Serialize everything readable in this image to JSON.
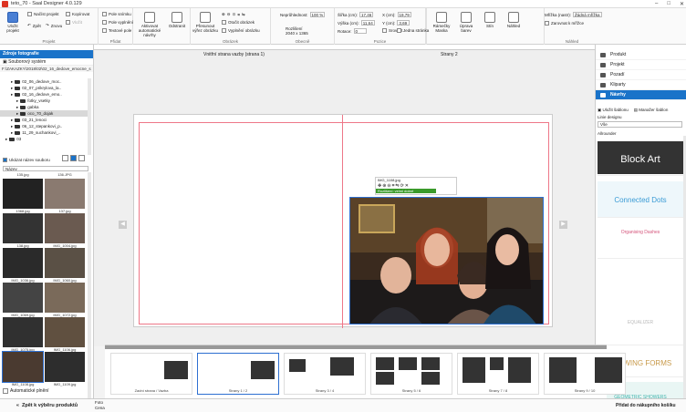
{
  "window": {
    "title": "teto_70 - Saal Designer 4.0.129"
  },
  "ribbon": {
    "save_project": "Uložit\nprojekt",
    "load_project": "Načíst projekt",
    "copy": "Kopírovat",
    "insert": "Vložit",
    "undo": "Zpět",
    "redo": "Znovu",
    "group_project": "Projekt",
    "photo_box": "Pole snímku",
    "fill_box": "Pole vyplnění",
    "text_box": "Textové pole",
    "group_add": "Přidat",
    "update_layouts": "Aktivovat automatické návrhy",
    "delete": "Odstranit",
    "move_image": "Přesunout výřez obrázku",
    "group_image": "Obrázek",
    "rotate_image": "Otočit obrázek",
    "fill_image": "Vyplnění obrázku",
    "resolution_label": "Rozlišení",
    "resolution_value": "2040 x 1365",
    "transparency_label": "Neprůhlednost:",
    "transparency_value": "100 %",
    "group_general": "Obecně",
    "width_label": "Šířka (cm):",
    "width_value": "17,46",
    "height_label": "Výška (cm):",
    "height_value": "11,64",
    "rotation_label": "Rotace:",
    "rotation_value": "0",
    "x_label": "X (cm):",
    "x_value": "19,79",
    "y_label": "Y (cm):",
    "y_value": "3,69",
    "align_label": "Srovnat",
    "single_page": "Jedna stránka",
    "group_position": "Pozice",
    "frames_mask": "Rámečky Maska",
    "filter_colors": "Úprava barev",
    "shadow": "Stín",
    "preview": "Náhled",
    "grid_label": "Mřížka (nastr):",
    "grid_value": "Žádná mřížka",
    "snap_grid": "Zarovnat k mřížce",
    "group_view": "Náhled"
  },
  "left": {
    "header": "Zdroje fotografie",
    "source": "Souborový systém",
    "path": "F:\\ZAKAZKY\\2018\\02\\02_16_dedove_emocne_s",
    "tree": [
      {
        "label": "02_06_dedove_moc..",
        "indent": 2
      },
      {
        "label": "02_07_prikrylova_la..",
        "indent": 2
      },
      {
        "label": "02_16_dedove_emo..",
        "indent": 2
      },
      {
        "label": "fotky_vsetky",
        "indent": 3
      },
      {
        "label": "gabka",
        "indent": 3
      },
      {
        "label": "oco_70_dojak",
        "indent": 3,
        "selected": true
      },
      {
        "label": "03_21_lenoci",
        "indent": 2
      },
      {
        "label": "06_12_stepankovi_p..",
        "indent": 2
      },
      {
        "label": "11_29_suchankovi_..",
        "indent": 2
      },
      {
        "label": "03",
        "indent": 1
      }
    ],
    "show_names": "Ukázat název souboru",
    "sort_label": "Název",
    "thumbs": [
      "135.jpg",
      "136.JPG",
      "1368.jpg",
      "137.jpg",
      "138.jpg",
      "IMG_1004.jpg",
      "IMG_1036.jpg",
      "IMG_1060.jpg",
      "IMG_1069.jpg",
      "IMG_1072.jpg",
      "IMG_1075.jpg",
      "IMG_1106.jpg",
      "IMG_1108.jpg",
      "IMG_1109.jpg"
    ],
    "auto_fill": "Automatické plnění",
    "back_button": "Zpět k výběru produktů"
  },
  "canvas": {
    "left_label": "Vnitřní strana vazby (strana 1)",
    "right_label": "Strany 2",
    "photo_name": "IMG_1108.jpg",
    "resolution_badge": "Rozlišení: velmi dobré"
  },
  "right": {
    "items": [
      "Produkt",
      "Projekt",
      "Pozadí",
      "Kliparty",
      "Návrhy"
    ],
    "save_layout": "Uložit šablonu",
    "manage_layouts": "Manažer šablon",
    "layout_line_label": "Linie designu",
    "layout_line_value": "Vše",
    "allrounder": "Allrounder",
    "designs": [
      "Block Art",
      "Connected Dots",
      "Organising Dashes",
      "EQUALIZER",
      "FLOWING FORMS",
      "GEOMETRIC SHOWERS"
    ],
    "cart_button": "Přidat do nákupního košíku"
  },
  "filmstrip": {
    "pages": [
      "Zadní strana / Vazba",
      "Strany 1 / 2",
      "Strany 3 / 4",
      "Strany 5 / 6",
      "Strany 7 / 8",
      "Strany 9 / 10"
    ]
  },
  "bottom": {
    "photo_label": "Foto",
    "price_label": "Cena"
  }
}
